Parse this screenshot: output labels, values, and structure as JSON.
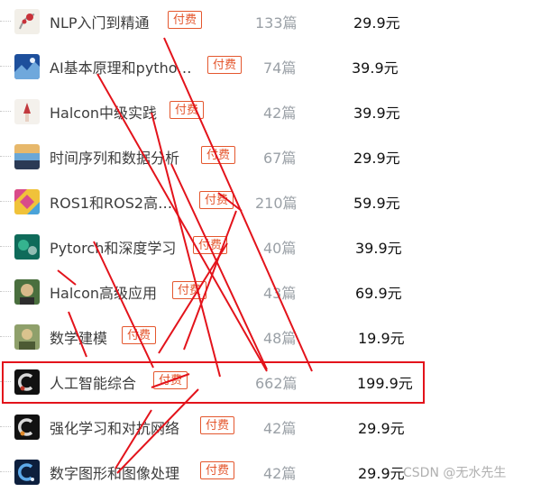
{
  "courses": [
    {
      "title": "NLP入门到精通",
      "badge": "付费",
      "count": "133篇",
      "price": "29.9元",
      "thumb_colors": [
        "#f2efe8",
        "#c8323a",
        "#9a9a9a"
      ]
    },
    {
      "title": "AI基本原理和pytho…",
      "badge": "付费",
      "count": "74篇",
      "price": "39.9元",
      "thumb_colors": [
        "#1d4f9c",
        "#6fa8dc",
        "#e9f1fb"
      ]
    },
    {
      "title": "Halcon中级实践",
      "badge": "付费",
      "count": "42篇",
      "price": "39.9元",
      "thumb_colors": [
        "#f4f1ec",
        "#c2393e",
        "#e8cfc2"
      ]
    },
    {
      "title": "时间序列和数据分析",
      "badge": "付费",
      "count": "67篇",
      "price": "29.9元",
      "thumb_colors": [
        "#e7b86b",
        "#6aa7d6",
        "#2b3a55"
      ]
    },
    {
      "title": "ROS1和ROS2高…",
      "badge": "付费",
      "count": "210篇",
      "price": "59.9元",
      "thumb_colors": [
        "#d94b8a",
        "#f0c23a",
        "#4aa3d9"
      ]
    },
    {
      "title": "Pytorch和深度学习",
      "badge": "付费",
      "count": "40篇",
      "price": "39.9元",
      "thumb_colors": [
        "#0f6b5a",
        "#35b38f",
        "#e8f3ee"
      ]
    },
    {
      "title": "Halcon高级应用",
      "badge": "付费",
      "count": "43篇",
      "price": "69.9元",
      "thumb_colors": [
        "#4a6f3e",
        "#d8b98a",
        "#2d2d2d"
      ]
    },
    {
      "title": "数学建模",
      "badge": "付费",
      "count": "48篇",
      "price": "19.9元",
      "thumb_colors": [
        "#8fa06b",
        "#d9c38e",
        "#4c5a34"
      ]
    },
    {
      "title": "人工智能综合",
      "badge": "付费",
      "count": "662篇",
      "price": "199.9元",
      "thumb_colors": [
        "#111111",
        "#d8d8d8",
        "#c0392b"
      ]
    },
    {
      "title": "强化学习和对抗网络",
      "badge": "付费",
      "count": "42篇",
      "price": "29.9元",
      "thumb_colors": [
        "#111111",
        "#d8d8d8",
        "#e08a2a"
      ]
    },
    {
      "title": "数字图形和图像处理",
      "badge": "付费",
      "count": "42篇",
      "price": "29.9元",
      "thumb_colors": [
        "#0d1f3d",
        "#5da9e9",
        "#dfe9f5"
      ]
    }
  ],
  "highlight_color": "#e3131b",
  "watermark": "CSDN @无水先生"
}
